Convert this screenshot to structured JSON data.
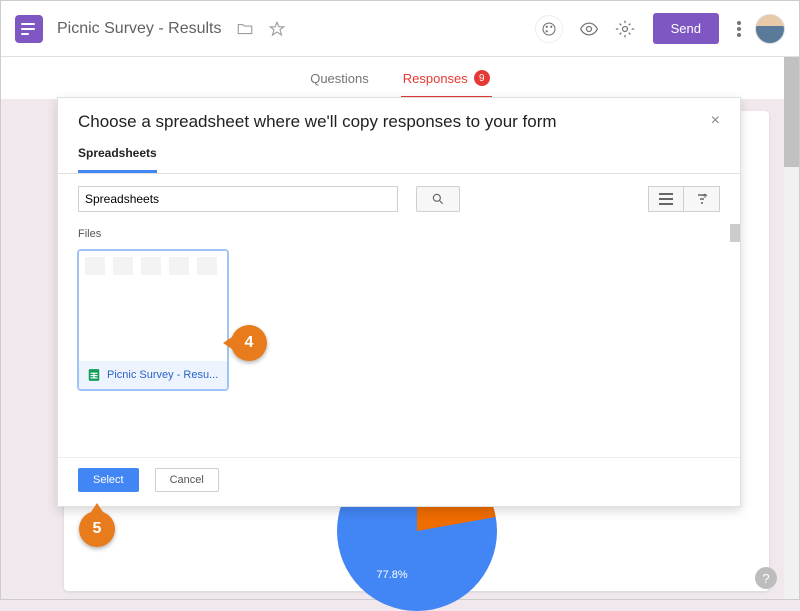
{
  "header": {
    "doc_title": "Picnic Survey - Results",
    "send_label": "Send"
  },
  "tabs": {
    "questions": "Questions",
    "responses": "Responses",
    "responses_count": "9"
  },
  "chart": {
    "primary_label": "77.8%"
  },
  "modal": {
    "title": "Choose a spreadsheet where we'll copy responses to your form",
    "tab_label": "Spreadsheets",
    "search_value": "Spreadsheets",
    "files_label": "Files",
    "file_name": "Picnic Survey - Resu...",
    "select_label": "Select",
    "cancel_label": "Cancel"
  },
  "callouts": {
    "c4": "4",
    "c5": "5"
  }
}
